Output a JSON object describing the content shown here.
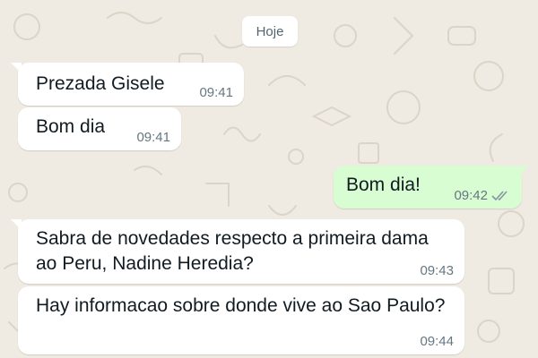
{
  "date_divider": "Hoje",
  "messages": [
    {
      "direction": "incoming",
      "text": "Prezada Gisele",
      "time": "09:41"
    },
    {
      "direction": "incoming",
      "text": "Bom dia",
      "time": "09:41"
    },
    {
      "direction": "outgoing",
      "text": "Bom dia!",
      "time": "09:42",
      "status": "read"
    },
    {
      "direction": "incoming",
      "text": "Sabra de novedades respecto a primeira dama ao Peru, Nadine Heredia?",
      "time": "09:43"
    },
    {
      "direction": "incoming",
      "text": "Hay informacao sobre donde vive ao Sao Paulo?",
      "time": "09:44"
    }
  ],
  "colors": {
    "background": "#efeae2",
    "incoming_bubble": "#ffffff",
    "outgoing_bubble": "#d9fdd3",
    "timestamp": "#667781",
    "read_ticks": "#8696a0"
  }
}
